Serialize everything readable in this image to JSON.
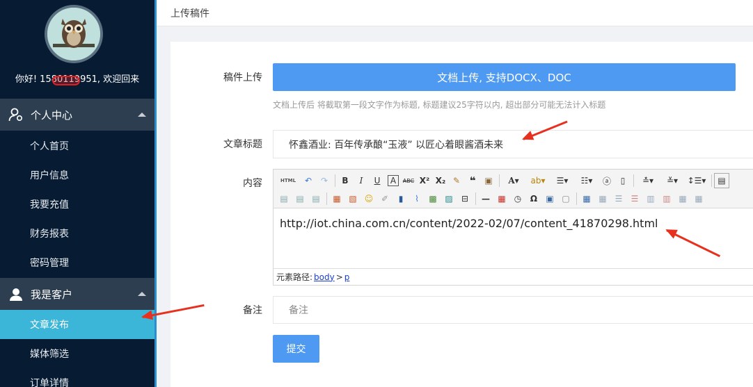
{
  "user": {
    "greeting_prefix": "你好! ",
    "phone": "1580",
    "phone_hidden": "11995",
    "phone_tail": "1",
    "greeting_suffix": ", 欢迎回来"
  },
  "sidebar": {
    "sections": [
      {
        "label": "个人中心",
        "icon": "user-gear-icon",
        "items": [
          {
            "label": "个人首页",
            "active": false
          },
          {
            "label": "用户信息",
            "active": false
          },
          {
            "label": "我要充值",
            "active": false
          },
          {
            "label": "财务报表",
            "active": false
          },
          {
            "label": "密码管理",
            "active": false
          }
        ]
      },
      {
        "label": "我是客户",
        "icon": "customer-headset-icon",
        "items": [
          {
            "label": "文章发布",
            "active": true
          },
          {
            "label": "媒体筛选",
            "active": false
          },
          {
            "label": "订单详情",
            "active": false
          }
        ]
      }
    ]
  },
  "header": {
    "title": "上传稿件"
  },
  "form": {
    "upload_label": "稿件上传",
    "upload_button": "文档上传, 支持DOCX、DOC",
    "upload_hint": "文档上传后 将截取第一段文字作为标题, 标题建议25字符以内, 超出部分可能无法计入标题",
    "title_label": "文章标题",
    "title_value": "怀鑫酒业: 百年传承酿“玉液” 以匠心着眼酱酒未来",
    "content_label": "内容",
    "content_value": "http://iot.china.com.cn/content/2022-02/07/content_41870298.html",
    "path_label": "元素路径:",
    "path_body": "body",
    "path_sep": ">",
    "path_p": "p",
    "remark_label": "备注",
    "remark_placeholder": "备注",
    "submit_button": "提交"
  },
  "editor_toolbar": {
    "row1": [
      "source-html-icon",
      "undo-icon",
      "redo-icon",
      "sep",
      "bold-icon",
      "italic-icon",
      "underline-icon",
      "font-border-icon",
      "strikethrough-icon",
      "superscript-icon",
      "subscript-icon",
      "format-brush-icon",
      "blockquote-icon",
      "paste-text-icon",
      "sep",
      "font-color-icon",
      "highlight-icon",
      "ordered-list-icon",
      "unordered-list-icon",
      "select-all-icon",
      "clear-doc-icon",
      "sep",
      "row-spacing-top-icon",
      "row-spacing-bottom-icon",
      "line-height-icon",
      "sep",
      "more-icon"
    ],
    "row2": [
      "align-left-icon",
      "align-right-icon",
      "align-center-icon",
      "sep",
      "image-icon",
      "image-gallery-icon",
      "emoji-icon",
      "scrawl-icon",
      "video-icon",
      "attachment-icon",
      "map-icon",
      "gmap-icon",
      "pagebreak-icon",
      "sep",
      "horizontal-rule-icon",
      "date-icon",
      "time-icon",
      "special-char-icon",
      "template-icon",
      "preview-icon",
      "sep",
      "insert-table-icon",
      "delete-table-icon",
      "insert-row-icon",
      "delete-row-icon",
      "insert-col-icon",
      "delete-col-icon",
      "merge-cells-icon",
      "split-cells-icon"
    ],
    "labels": {
      "source": "HTML",
      "bold": "B",
      "italic": "I",
      "underline": "U",
      "border": "A",
      "strike": "ABC",
      "sup": "X²",
      "sub": "X₂",
      "quote": "❝",
      "fontcolor": "A",
      "omega": "Ω"
    }
  },
  "colors": {
    "sidebar_bg": "#071b33",
    "section_bg": "#2c3e50",
    "active_item": "#3cb6d8",
    "primary_button": "#4e9af2",
    "annotation_arrow": "#e8301f"
  }
}
